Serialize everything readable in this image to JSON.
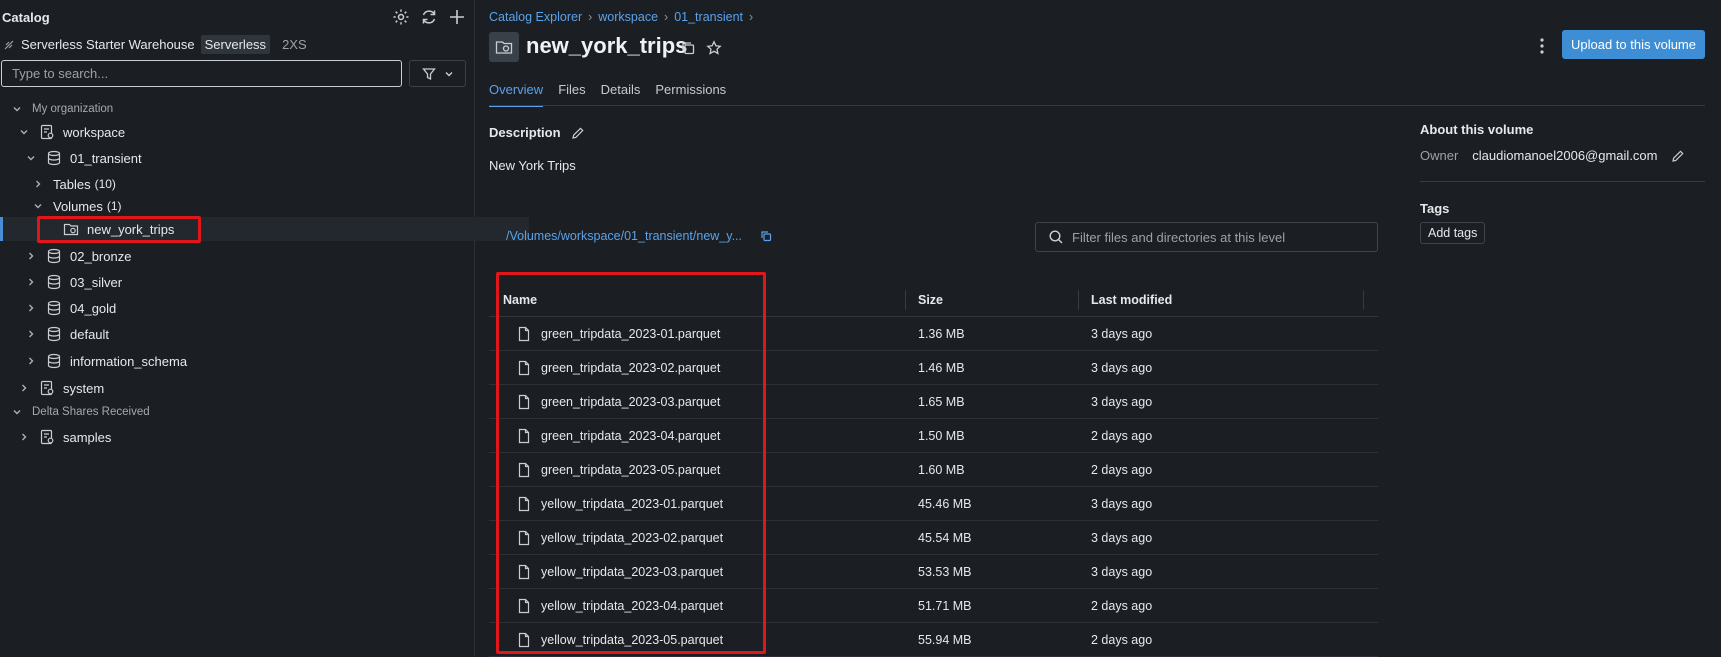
{
  "sidebar": {
    "title": "Catalog",
    "warehouse": {
      "name": "Serverless Starter Warehouse",
      "type": "Serverless",
      "size": "2XS"
    },
    "search_placeholder": "Type to search...",
    "tree": {
      "my_org": "My organization",
      "workspace": "workspace",
      "transient": "01_transient",
      "tables": "Tables",
      "tables_count": "(10)",
      "volumes": "Volumes",
      "volumes_count": "(1)",
      "new_york_trips": "new_york_trips",
      "bronze": "02_bronze",
      "silver": "03_silver",
      "gold": "04_gold",
      "default": "default",
      "information_schema": "information_schema",
      "system": "system",
      "delta_shares": "Delta Shares Received",
      "samples": "samples"
    }
  },
  "breadcrumb": [
    "Catalog Explorer",
    "workspace",
    "01_transient"
  ],
  "page": {
    "title": "new_york_trips",
    "upload_label": "Upload to this volume",
    "tabs": [
      "Overview",
      "Files",
      "Details",
      "Permissions"
    ],
    "description_heading": "Description",
    "description": "New York Trips",
    "path": "/Volumes/workspace/01_transient/new_y...",
    "filter_placeholder": "Filter files and directories at this level"
  },
  "files_table": {
    "headers": {
      "name": "Name",
      "size": "Size",
      "modified": "Last modified"
    },
    "rows": [
      {
        "name": "green_tripdata_2023-01.parquet",
        "size": "1.36 MB",
        "modified": "3 days ago"
      },
      {
        "name": "green_tripdata_2023-02.parquet",
        "size": "1.46 MB",
        "modified": "3 days ago"
      },
      {
        "name": "green_tripdata_2023-03.parquet",
        "size": "1.65 MB",
        "modified": "3 days ago"
      },
      {
        "name": "green_tripdata_2023-04.parquet",
        "size": "1.50 MB",
        "modified": "2 days ago"
      },
      {
        "name": "green_tripdata_2023-05.parquet",
        "size": "1.60 MB",
        "modified": "2 days ago"
      },
      {
        "name": "yellow_tripdata_2023-01.parquet",
        "size": "45.46 MB",
        "modified": "3 days ago"
      },
      {
        "name": "yellow_tripdata_2023-02.parquet",
        "size": "45.54 MB",
        "modified": "3 days ago"
      },
      {
        "name": "yellow_tripdata_2023-03.parquet",
        "size": "53.53 MB",
        "modified": "3 days ago"
      },
      {
        "name": "yellow_tripdata_2023-04.parquet",
        "size": "51.71 MB",
        "modified": "2 days ago"
      },
      {
        "name": "yellow_tripdata_2023-05.parquet",
        "size": "55.94 MB",
        "modified": "2 days ago"
      }
    ]
  },
  "about": {
    "heading": "About this volume",
    "owner_label": "Owner",
    "owner": "claudiomanoel2006@gmail.com",
    "tags_heading": "Tags",
    "add_tags_label": "Add tags"
  },
  "colors": {
    "accent": "#3e8ed6",
    "link": "#5aa2ea",
    "highlight": "#e0161b",
    "background": "#1b1f24"
  }
}
